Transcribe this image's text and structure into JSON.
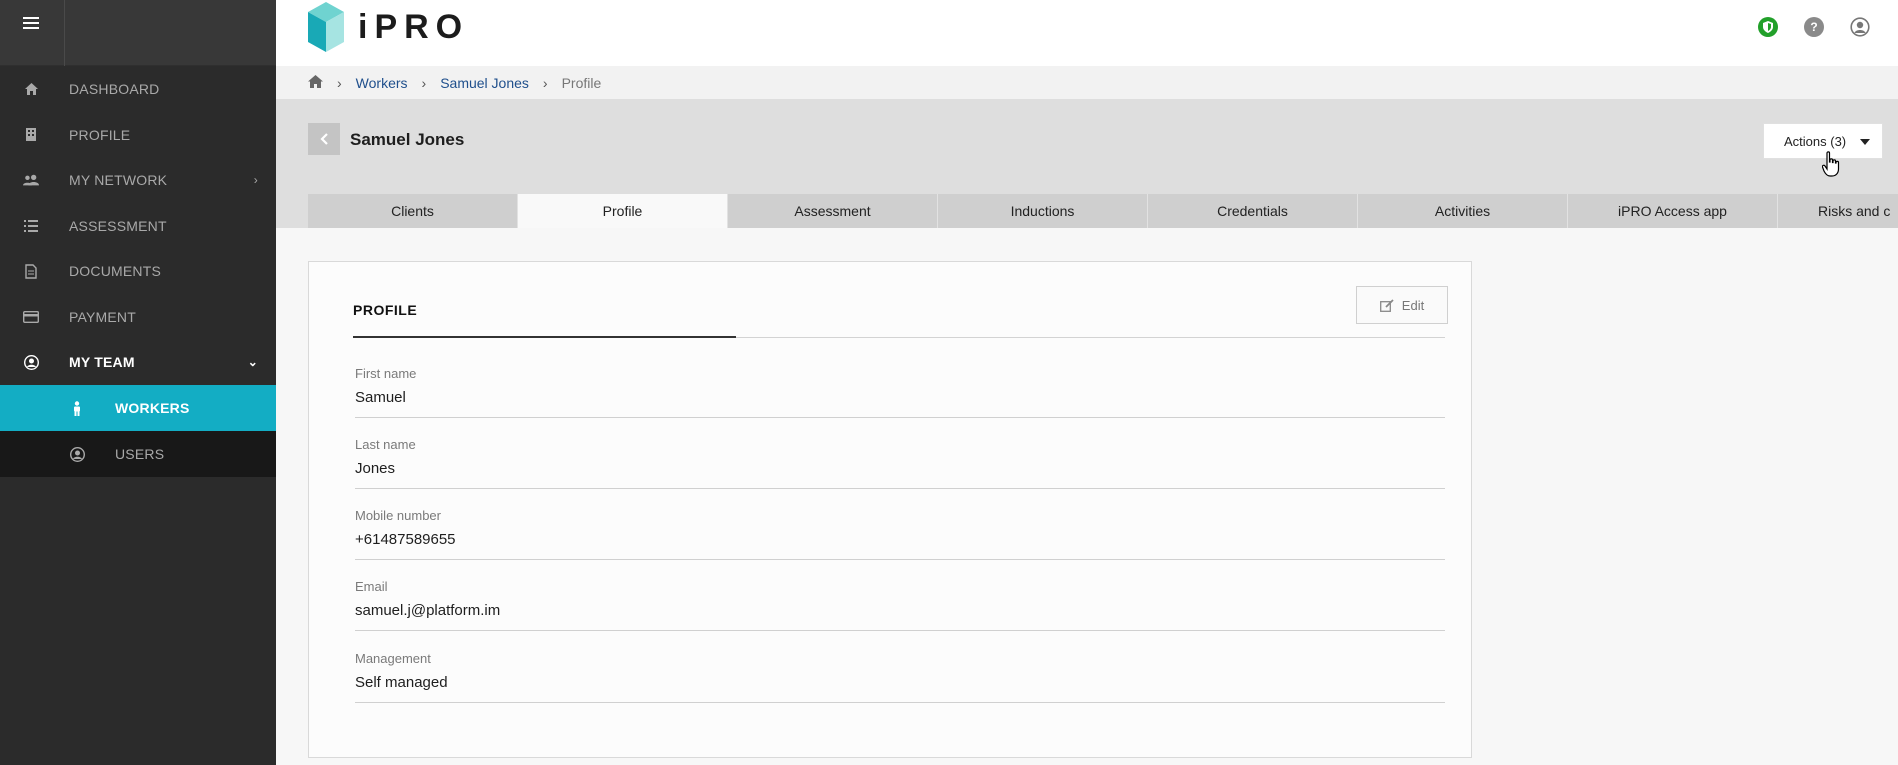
{
  "header": {
    "logo_text": "iPRO",
    "colors": {
      "accent": "#13adc4",
      "shield": "#22a02a"
    },
    "icons": [
      "shield-icon",
      "help-icon",
      "user-account-icon"
    ]
  },
  "sidebar": {
    "items": [
      {
        "label": "DASHBOARD",
        "icon": "home-icon"
      },
      {
        "label": "PROFILE",
        "icon": "building-icon"
      },
      {
        "label": "MY NETWORK",
        "icon": "users-icon",
        "chevron": "›"
      },
      {
        "label": "ASSESSMENT",
        "icon": "list-icon"
      },
      {
        "label": "DOCUMENTS",
        "icon": "document-icon"
      },
      {
        "label": "PAYMENT",
        "icon": "credit-card-icon"
      },
      {
        "label": "MY TEAM",
        "icon": "user-circle-icon",
        "chevron": "⌄"
      }
    ],
    "subitems": [
      {
        "label": "WORKERS",
        "icon": "worker-icon"
      },
      {
        "label": "USERS",
        "icon": "user-circle-icon"
      }
    ]
  },
  "breadcrumb": {
    "items": [
      "Workers",
      "Samuel Jones"
    ],
    "current": "Profile",
    "separator": "›"
  },
  "titlebar": {
    "title": "Samuel Jones",
    "actions_label": "Actions (3)"
  },
  "tabs": [
    {
      "label": "Clients"
    },
    {
      "label": "Profile"
    },
    {
      "label": "Assessment"
    },
    {
      "label": "Inductions"
    },
    {
      "label": "Credentials"
    },
    {
      "label": "Activities"
    },
    {
      "label": "iPRO Access app"
    },
    {
      "label": "Risks and c"
    }
  ],
  "profile": {
    "section_title": "PROFILE",
    "edit_label": "Edit",
    "fields": [
      {
        "label": "First name",
        "value": "Samuel"
      },
      {
        "label": "Last name",
        "value": "Jones"
      },
      {
        "label": "Mobile number",
        "value": "+61487589655"
      },
      {
        "label": "Email",
        "value": "samuel.j@platform.im"
      },
      {
        "label": "Management",
        "value": "Self managed"
      }
    ]
  }
}
